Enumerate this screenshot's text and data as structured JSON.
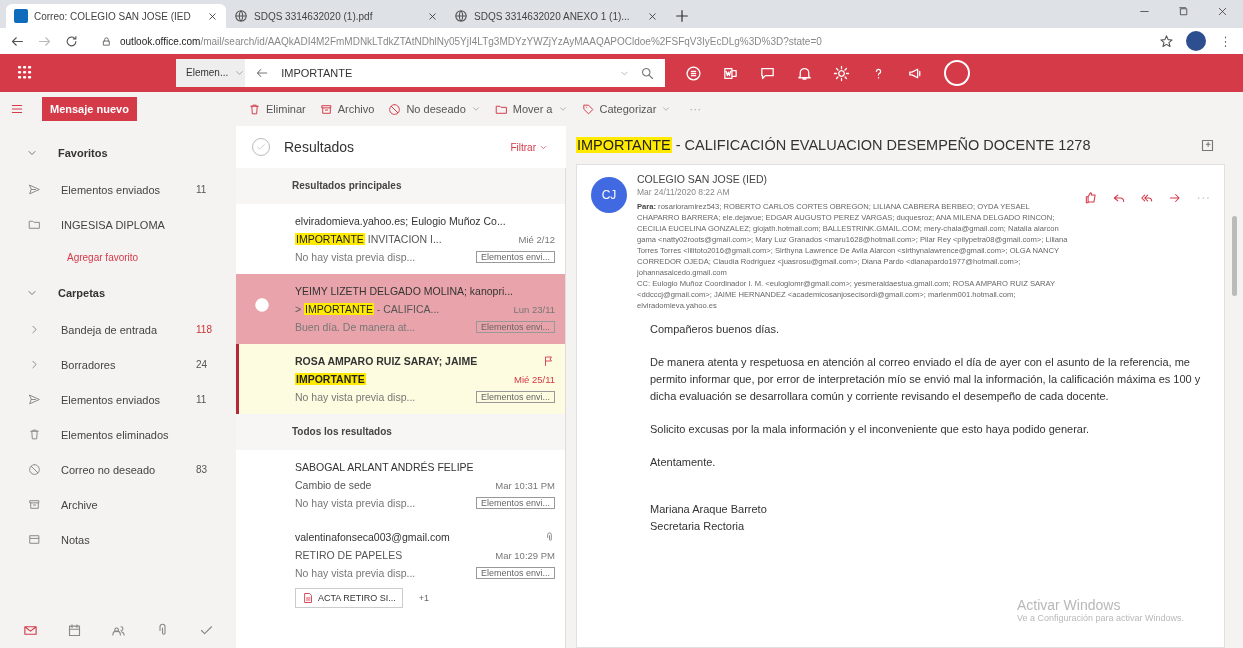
{
  "browser": {
    "tabs": [
      {
        "title": "Correo: COLEGIO SAN JOSE (IED",
        "selected": true
      },
      {
        "title": "SDQS 3314632020 (1).pdf",
        "selected": false
      },
      {
        "title": "SDQS 3314632020 ANEXO 1 (1)...",
        "selected": false
      }
    ],
    "url_host": "outlook.office.com",
    "url_path": "/mail/search/id/AAQkADI4M2FmMDNkLTdkZTAtNDhlNy05YjI4LTg3MDYzYWZjYzAyMAAQAPOCldoe%2FSFqV3IyEcDLg%3D%3D?state=0"
  },
  "header": {
    "scope": "Elemen...",
    "query": "IMPORTANTE"
  },
  "toolbar": {
    "new_message": "Mensaje nuevo",
    "actions": [
      {
        "label": "Eliminar",
        "dropdown": false
      },
      {
        "label": "Archivo",
        "dropdown": false
      },
      {
        "label": "No deseado",
        "dropdown": true
      },
      {
        "label": "Mover a",
        "dropdown": true
      },
      {
        "label": "Categorizar",
        "dropdown": true
      }
    ],
    "more": "···"
  },
  "sidebar": {
    "groups": [
      {
        "title": "Favoritos",
        "expanded": true,
        "items": [
          {
            "label": "Elementos enviados",
            "count": "11",
            "kind": "sent"
          },
          {
            "label": "INGESISA DIPLOMA",
            "kind": "folder"
          },
          {
            "label": "Agregar favorito",
            "kind": "link"
          }
        ]
      },
      {
        "title": "Carpetas",
        "expanded": true,
        "items": [
          {
            "label": "Bandeja de entrada",
            "count": "118",
            "kind": "parent",
            "count_accent": true
          },
          {
            "label": "Borradores",
            "count": "24",
            "kind": "parent",
            "count_accent": false
          },
          {
            "label": "Elementos enviados",
            "count": "11",
            "kind": "sent",
            "count_accent": false
          },
          {
            "label": "Elementos eliminados",
            "kind": "deleted"
          },
          {
            "label": "Correo no deseado",
            "count": "83",
            "kind": "junk",
            "count_accent": false
          },
          {
            "label": "Archive",
            "kind": "archive"
          },
          {
            "label": "Notas",
            "kind": "notes"
          }
        ]
      }
    ]
  },
  "message_list": {
    "title": "Resultados",
    "filter": "Filtrar",
    "sections": [
      {
        "title": "Resultados principales",
        "items": [
          {
            "sender": "elviradomieva.yahoo.es; Eulogio Muñoz Co...",
            "highlight": "IMPORTANTE",
            "subject": " INVITACION I...",
            "date": "Mié 2/12",
            "preview": "No hay vista previa disp...",
            "folder": "Elementos envi...",
            "selected": false,
            "flagged": false
          },
          {
            "sender": "YEIMY LIZETH DELGADO MOLINA; kanopri...",
            "prefix": "> ",
            "highlight": "IMPORTANTE",
            "subject": " - CALIFICA...",
            "date": "Lun 23/11",
            "preview": "Buen día. De manera at...",
            "folder": "Elementos envi...",
            "selected": true,
            "flagged": false
          },
          {
            "sender": "ROSA AMPARO RUIZ SARAY; JAIME",
            "highlight": "IMPORTANTE",
            "date": "Mié 25/11",
            "preview": "No hay vista previa disp...",
            "folder": "Elementos envi...",
            "selected": false,
            "flagged": true
          }
        ]
      },
      {
        "title": "Todos los resultados",
        "items": [
          {
            "sender": "SABOGAL ARLANT ANDRÉS FELIPE",
            "subject": "Cambio de sede",
            "date": "Mar 10:31 PM",
            "preview": "No hay vista previa disp...",
            "folder": "Elementos envi...",
            "selected": false,
            "flagged": false
          },
          {
            "sender": "valentinafonseca003@gmail.com",
            "subject": "RETIRO DE PAPELES",
            "date": "Mar 10:29 PM",
            "preview": "No hay vista previa disp...",
            "folder": "Elementos envi...",
            "selected": false,
            "flagged": false,
            "attachment": "ACTA RETIRO SI...",
            "more_attachments": "+1"
          }
        ]
      }
    ]
  },
  "reading": {
    "subject_highlight": "IMPORTANTE",
    "subject_rest": " - CALIFICACIÓN EVALUACION DESEMPEÑO DOCENTE 1278",
    "sender": "COLEGIO SAN JOSE (IED)",
    "initials": "CJ",
    "date": "Mar 24/11/2020 8:22 AM",
    "to": "**Para:** rosarioramirez543; ROBERTO CARLOS CORTES OBREGON; LILIANA CABRERA BERBEO; OYDA YESAEL CHAPARRO BARRERA; ele.dejavue; EDGAR AUGUSTO PEREZ VARGAS; duquesroz; ANA MILENA DELGADO RINCON; CECILIA EUCELINA GONZALEZ; glojath.hotmail.com; BALLESTRINK.GMAIL.COM; mery-chala@gmail.com; Natalia alarcon gama <natty02roots@gmail.com>; Mary Luz Granados <maru1628@hotmail.com>; Pilar Rey <pilypetra08@gmail.com>; Liliana Torres Torres <lilitoto2016@gmail.com>; Sirthyna Lawrence De Avila Alarcon <sirthynalawrence@gmail.com>; OLGA NANCY CORREDOR OJEDA; Claudia Rodriguez <juasrosu@gmail.com>; Diana Pardo <dianapardo1977@hotmail.com>; johannasalcedo.gmail.com",
    "cc": "CC: Eulogio Muñoz Coordinador I. M. <eulogiomr@gmail.com>; yesmeraldaestua.gmail.com; ROSA AMPARO RUIZ SARAY <ddcccj@gmail.com>; JAIME HERNANDEZ <academicosanjosecisordi@gmail.com>; marlenm001.hotmail.com; elviradomieva.yahoo.es",
    "body": [
      "Compañeros buenos días.",
      "De manera atenta y respetuosa en atención al correo enviado el día de ayer con el asunto de la referencia, me permito informar que, por error de interpretación mío se envió mal la información, la calificación máxima es 100 y dicha evaluación se desarrollara común y corriente revisando el desempeño de cada docente.",
      "Solicito excusas por la mala información y el inconveniente que esto haya podido generar.",
      "Atentamente."
    ],
    "signature": [
      "Mariana Araque Barreto",
      "Secretaria Rectoria"
    ]
  },
  "os_notice": {
    "title": "Activar Windows",
    "text": "Ve a Configuración para activar Windows."
  }
}
